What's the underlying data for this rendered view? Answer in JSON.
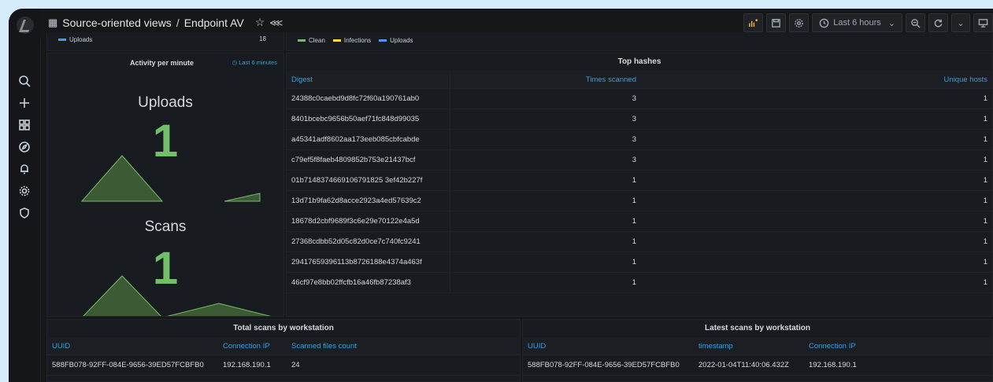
{
  "breadcrumb": {
    "folder": "Source-oriented views",
    "separator": "/",
    "dashboard": "Endpoint AV"
  },
  "topbar": {
    "time_range": "Last 6 hours"
  },
  "top_partial": {
    "left_legend": "Uploads",
    "left_value": "18",
    "legend": [
      "Clean",
      "Infections",
      "Uploads"
    ]
  },
  "activity": {
    "title": "Activity per minute",
    "range": "Last 6 minutes",
    "uploads_label": "Uploads",
    "uploads_value": "1",
    "scans_label": "Scans",
    "scans_value": "1"
  },
  "top_hashes": {
    "title": "Top hashes",
    "columns": [
      "Digest",
      "Times scanned",
      "Unique hosts"
    ],
    "rows": [
      [
        "24388c0caebd9d8fc72f60a190761ab0",
        "3",
        "1"
      ],
      [
        "8401bcebc9656b50aef71fc848d99035",
        "3",
        "1"
      ],
      [
        "a45341adf8602aa173eeb085cbfcabde",
        "3",
        "1"
      ],
      [
        "c79ef5f8faeb4809852b753e21437bcf",
        "3",
        "1"
      ],
      [
        "01b7148374669106791825 3ef42b227f",
        "1",
        "1"
      ],
      [
        "13d71b9fa62d8acce2923a4ed57639c2",
        "1",
        "1"
      ],
      [
        "18678d2cbf9689f3c6e29e70122e4a5d",
        "1",
        "1"
      ],
      [
        "27368cdbb52d05c82d0ce7c740fc9241",
        "1",
        "1"
      ],
      [
        "29417659396113b8726188e4374a463f",
        "1",
        "1"
      ],
      [
        "46cf97e8bb02ffcfb16a46fb87238af3",
        "1",
        "1"
      ]
    ]
  },
  "total_scans": {
    "title": "Total scans by workstation",
    "columns": [
      "UUID",
      "Connection IP",
      "Scanned files count"
    ],
    "rows": [
      [
        "588FB078-92FF-084E-9656-39ED57FCBFB0",
        "192.168.190.1",
        "24"
      ]
    ]
  },
  "latest_scans": {
    "title": "Latest scans by workstation",
    "columns": [
      "UUID",
      "timestamp",
      "Connection IP"
    ],
    "rows": [
      [
        "588FB078-92FF-084E-9656-39ED57FCBFB0",
        "2022-01-04T11:40:06.432Z",
        "192.168.190.1"
      ]
    ]
  },
  "colors": {
    "clean": "#73bf69",
    "infections": "#fade2a",
    "uploads": "#5794f2",
    "link": "#33a2e5"
  }
}
